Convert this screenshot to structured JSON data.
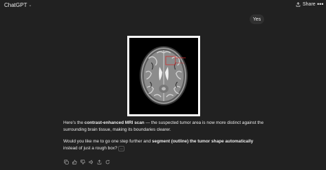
{
  "header": {
    "app_title": "ChatGPT",
    "share_label": "Share",
    "more_label": "•••"
  },
  "user_message": "Yes",
  "assistant": {
    "p1_pre": "Here’s the ",
    "p1_bold": "contrast-enhanced MRI scan",
    "p1_post": " — the suspected tumor area is now more distinct against the surrounding brain tissue, making its boundaries clearer.",
    "p2_pre": "Would you like me to go one step further and ",
    "p2_bold": "segment (outline) the tumor shape automatically",
    "p2_post": " instead of just a rough box? "
  },
  "icons": {
    "expand": "expand-icon",
    "actions": [
      "copy-icon",
      "thumbs-up-icon",
      "thumbs-down-icon",
      "speaker-icon",
      "upload-icon",
      "regenerate-icon"
    ]
  },
  "colors": {
    "background": "#212121",
    "bubble": "#303030",
    "text": "#ececec",
    "annotation": "#d03030"
  }
}
